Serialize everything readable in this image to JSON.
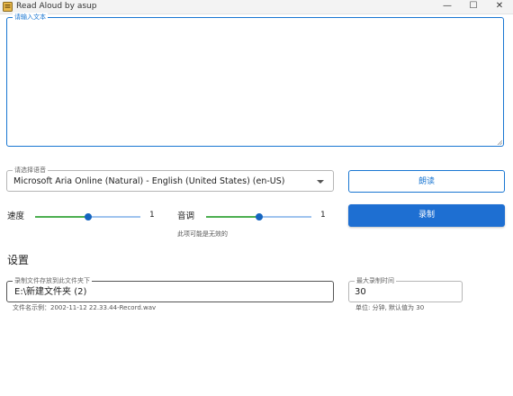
{
  "window": {
    "title": "Read Aloud by asup",
    "minimize_glyph": "—",
    "maximize_glyph": "☐",
    "close_glyph": "✕"
  },
  "text_input": {
    "label": "请输入文本",
    "value": ""
  },
  "voice": {
    "label": "请选择语音",
    "selected": "Microsoft Aria Online (Natural) - English (United States) (en-US)"
  },
  "buttons": {
    "read": "朗读",
    "record": "录制"
  },
  "speed": {
    "label": "速度",
    "value": "1",
    "level": 0.5
  },
  "pitch": {
    "label": "音调",
    "value": "1",
    "level": 0.5,
    "note": "此项可能是无效的"
  },
  "settings": {
    "title": "设置",
    "folder": {
      "label": "录制文件存放到此文件夹下",
      "value": "E:\\新建文件夹 (2)",
      "example": "文件名示例：2002-11-12 22.33.44-Record.wav"
    },
    "max_duration": {
      "label": "最大录制时间",
      "value": "30",
      "hint": "单位: 分钟, 默认值为 30"
    }
  },
  "colors": {
    "accent": "#1976d2",
    "record_button": "#1e6fd2",
    "slider_fill": "#4caf50",
    "slider_track": "#9fc3ee",
    "thumb": "#1565c0"
  }
}
